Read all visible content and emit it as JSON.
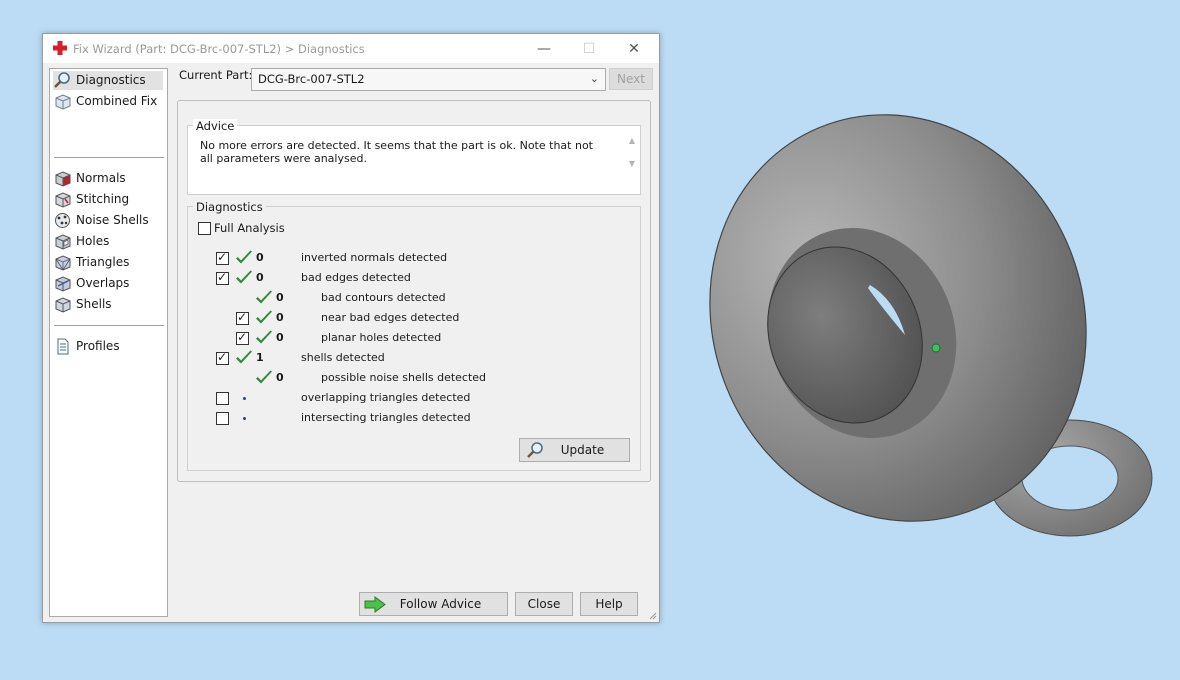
{
  "window": {
    "title": "Fix Wizard (Part: DCG-Brc-007-STL2) > Diagnostics",
    "controls": {
      "minimize": "—",
      "maximize": "☐",
      "close": "✕"
    }
  },
  "sidebar": {
    "groups": [
      [
        {
          "label": "Diagnostics",
          "icon": "magnifier-icon",
          "selected": true
        },
        {
          "label": "Combined Fix",
          "icon": "cube-icon",
          "selected": false
        }
      ],
      [
        {
          "label": "Normals",
          "icon": "normals-cube-icon"
        },
        {
          "label": "Stitching",
          "icon": "stitching-cube-icon"
        },
        {
          "label": "Noise Shells",
          "icon": "noise-shells-icon"
        },
        {
          "label": "Holes",
          "icon": "holes-cube-icon"
        },
        {
          "label": "Triangles",
          "icon": "triangles-cube-icon"
        },
        {
          "label": "Overlaps",
          "icon": "overlaps-cube-icon"
        },
        {
          "label": "Shells",
          "icon": "shells-cube-icon"
        }
      ],
      [
        {
          "label": "Profiles",
          "icon": "document-icon"
        }
      ]
    ]
  },
  "header": {
    "current_part_label": "Current Part:",
    "current_part_value": "DCG-Brc-007-STL2",
    "next_label": "Next"
  },
  "advice": {
    "title": "Advice",
    "text": "No more errors are detected. It seems that the part is ok. Note that not all parameters were analysed."
  },
  "diagnostics": {
    "title": "Diagnostics",
    "full_analysis_label": "Full Analysis",
    "full_analysis_checked": false,
    "rows": [
      {
        "checkbox": true,
        "checked": true,
        "status": "ok",
        "count": "0",
        "label": "inverted normals detected",
        "indent": 0
      },
      {
        "checkbox": true,
        "checked": true,
        "status": "ok",
        "count": "0",
        "label": "bad edges detected",
        "indent": 0
      },
      {
        "checkbox": false,
        "checked": false,
        "status": "ok",
        "count": "0",
        "label": "bad contours detected",
        "indent": 1
      },
      {
        "checkbox": true,
        "checked": true,
        "status": "ok",
        "count": "0",
        "label": "near bad edges detected",
        "indent": 1
      },
      {
        "checkbox": true,
        "checked": true,
        "status": "ok",
        "count": "0",
        "label": "planar holes detected",
        "indent": 1
      },
      {
        "checkbox": true,
        "checked": true,
        "status": "ok",
        "count": "1",
        "label": "shells detected",
        "indent": 0
      },
      {
        "checkbox": false,
        "checked": false,
        "status": "ok",
        "count": "0",
        "label": "possible noise shells detected",
        "indent": 1
      },
      {
        "checkbox": true,
        "checked": false,
        "status": "pending",
        "count": "",
        "label": "overlapping triangles detected",
        "indent": 0
      },
      {
        "checkbox": true,
        "checked": false,
        "status": "pending",
        "count": "",
        "label": "intersecting triangles detected",
        "indent": 0
      }
    ],
    "update_label": "Update"
  },
  "footer": {
    "follow_advice_label": "Follow Advice",
    "close_label": "Close",
    "help_label": "Help"
  },
  "colors": {
    "viewport_bg": "#bcdcf6",
    "check_green": "#2e8b3a",
    "model_gray": "#8a8a8a"
  }
}
